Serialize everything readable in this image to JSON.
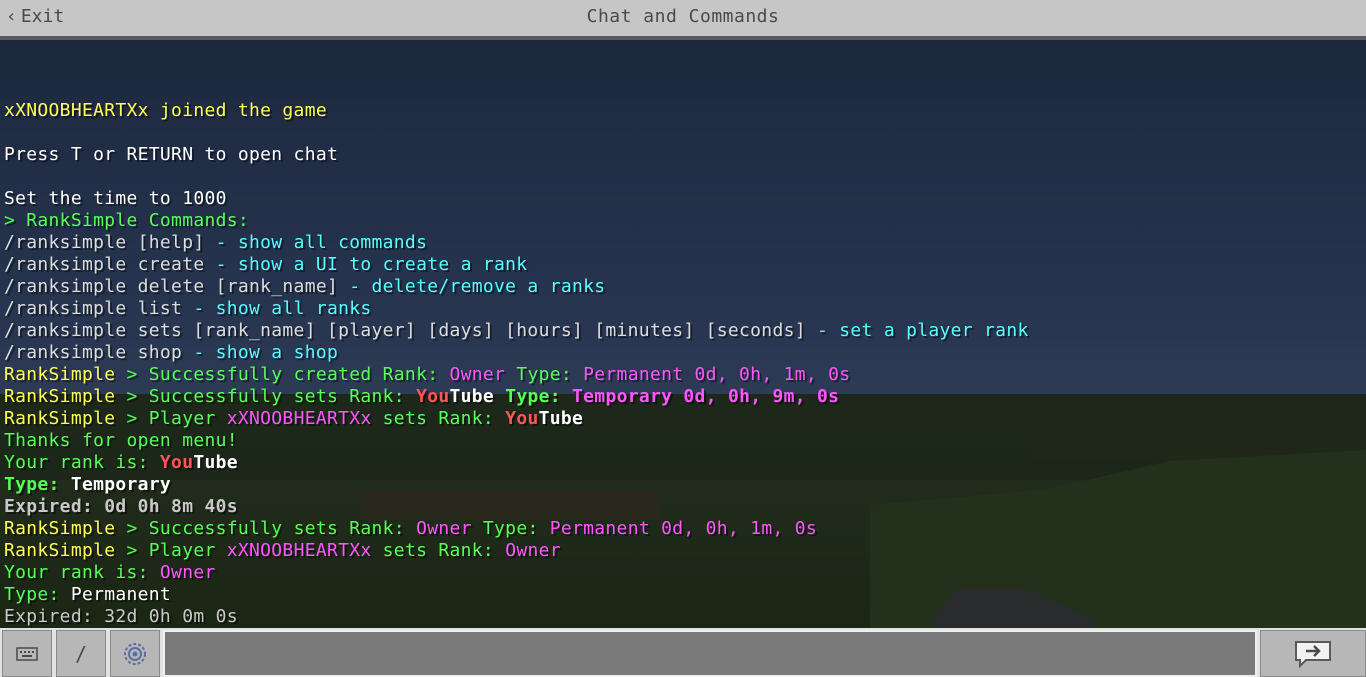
{
  "header": {
    "exit_label": "Exit",
    "title": "Chat and Commands"
  },
  "chat": {
    "joined": "xXNOOBHEARTXx joined the game",
    "hint": "Press T or RETURN to open chat",
    "time": "Set the time to 1000",
    "rs_header": "> RankSimple Commands:",
    "cmd1": {
      "cmd": "/ranksimple [help]",
      "desc": " - show all commands"
    },
    "cmd2": {
      "cmd": "/ranksimple create",
      "desc": " - show a UI to create a rank"
    },
    "cmd3": {
      "cmd": "/ranksimple delete [rank_name]",
      "desc": " - delete/remove a ranks"
    },
    "cmd4": {
      "cmd": "/ranksimple list",
      "desc": " - show all ranks"
    },
    "cmd5": {
      "cmd": "/ranksimple sets [rank_name] [player] [days] [hours] [minutes] [seconds]",
      "desc": " - set a player rank"
    },
    "cmd6": {
      "cmd": "/ranksimple shop",
      "desc": " - show a shop"
    },
    "m1": {
      "prefix": "RankSimple",
      "sep": " > Successfully created Rank: ",
      "rank": "Owner",
      "typelbl": " Type: ",
      "type": "Permanent 0d, 0h, 1m, 0s"
    },
    "m2": {
      "prefix": "RankSimple",
      "sep": " > Successfully sets Rank: ",
      "rank_a": "You",
      "rank_b": "Tube",
      "typelbl": " Type: ",
      "type": "Temporary 0d, 0h, 9m, 0s"
    },
    "m3": {
      "prefix": "RankSimple",
      "sep": " > Player ",
      "player": "xXNOOBHEARTXx",
      "mid": " sets Rank: ",
      "rank_a": "You",
      "rank_b": "Tube"
    },
    "m4": "Thanks for open menu!",
    "m5": {
      "lbl": "Your rank is: ",
      "rank_a": "You",
      "rank_b": "Tube"
    },
    "m6": {
      "lbl": "Type: ",
      "val": "Temporary"
    },
    "m7": "Expired: 0d 0h 8m 40s",
    "m8": {
      "prefix": "RankSimple",
      "sep": " > Successfully sets Rank: ",
      "rank": "Owner",
      "typelbl": " Type: ",
      "type": "Permanent 0d, 0h, 1m, 0s"
    },
    "m9": {
      "prefix": "RankSimple",
      "sep": " > Player ",
      "player": "xXNOOBHEARTXx",
      "mid": " sets Rank: ",
      "rank": "Owner"
    },
    "m10": {
      "lbl": "Your rank is: ",
      "rank": "Owner"
    },
    "m11": {
      "lbl": "Type: ",
      "val": "Permanent"
    },
    "m12": "Expired: 32d 0h 0m 0s"
  },
  "input": {
    "value": ""
  },
  "icons": {
    "keyboard": "keyboard-icon",
    "slash": "/",
    "settings": "gear-icon",
    "send": "send-arrow-icon"
  }
}
